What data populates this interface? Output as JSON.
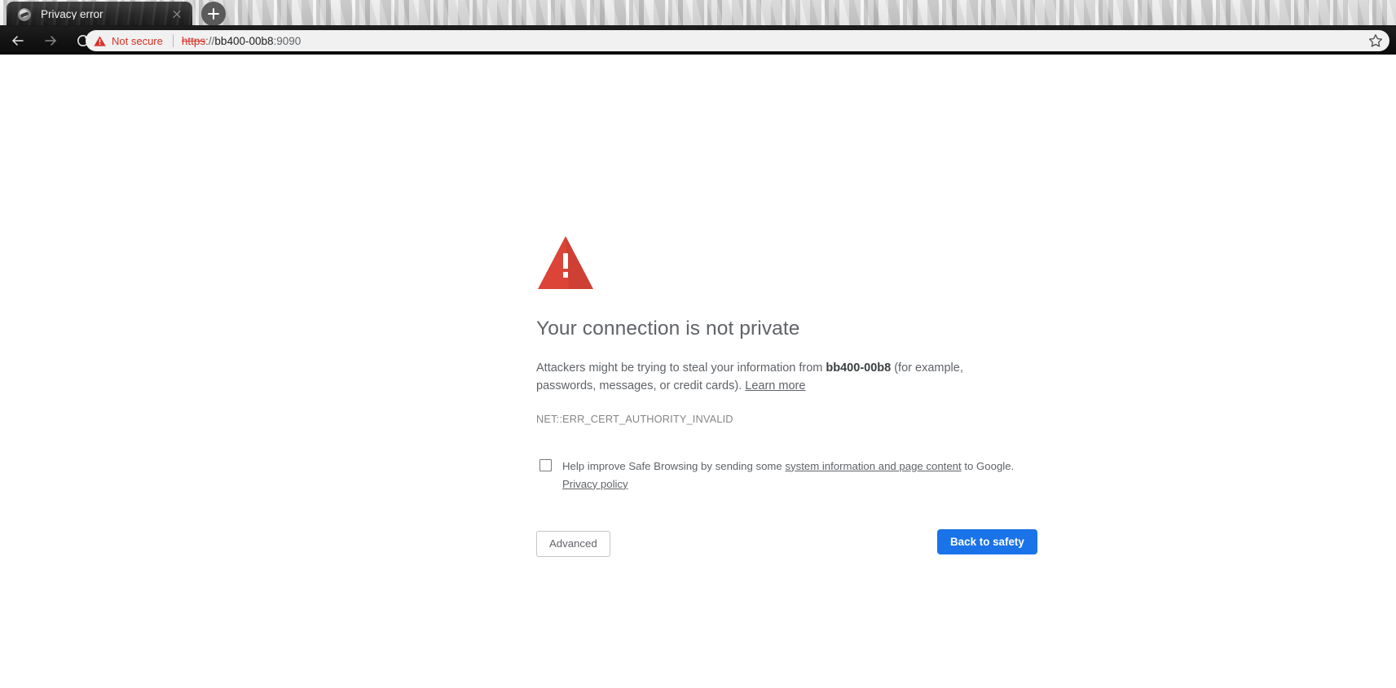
{
  "browser": {
    "tab": {
      "title": "Privacy error",
      "favicon_icon": "globe-icon",
      "close_icon": "close-icon"
    },
    "new_tab_icon": "plus-icon",
    "toolbar": {
      "back_icon": "arrow-left-icon",
      "forward_icon": "arrow-right-icon",
      "reload_icon": "reload-icon",
      "bookmark_icon": "star-outline-icon"
    },
    "omnibox": {
      "security_icon": "warning-triangle-icon",
      "security_label": "Not secure",
      "url_scheme": "https",
      "url_separator": "://",
      "url_host": "bb400-00b8",
      "url_port": ":9090",
      "full_url": "https://bb400-00b8:9090"
    }
  },
  "interstitial": {
    "icon": "warning-triangle-icon",
    "heading": "Your connection is not private",
    "body_prefix": "Attackers might be trying to steal your information from ",
    "body_host": "bb400-00b8",
    "body_middle": " (for example, passwords, messages, or credit cards). ",
    "learn_more_link": "Learn more",
    "error_code": "NET::ERR_CERT_AUTHORITY_INVALID",
    "safe_browsing": {
      "checked": false,
      "text_prefix": "Help improve Safe Browsing by sending some ",
      "link_text": "system information and page content",
      "text_suffix": " to Google. ",
      "privacy_policy_link": "Privacy policy"
    },
    "advanced_button": "Advanced",
    "back_to_safety_button": "Back to safety"
  },
  "colors": {
    "danger_red": "#d93025",
    "triangle_red": "#db4437",
    "primary_blue": "#1a73e8",
    "text_gray": "#5f6368"
  }
}
